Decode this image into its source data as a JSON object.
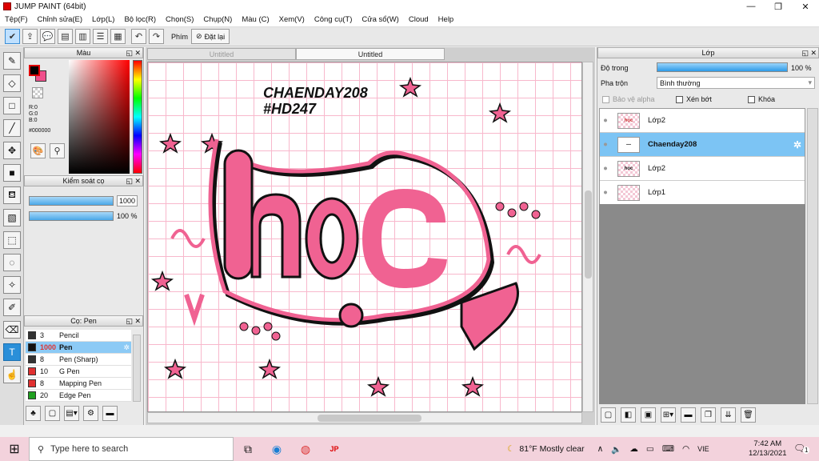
{
  "window": {
    "title": "JUMP PAINT (64bit)",
    "min": "—",
    "max": "❐",
    "close": "✕"
  },
  "menu": [
    "Tệp(F)",
    "Chỉnh sửa(E)",
    "Lớp(L)",
    "Bộ lọc(R)",
    "Chọn(S)",
    "Chụp(N)",
    "Màu (C)",
    "Xem(V)",
    "Công cụ(T)",
    "Cửa sổ(W)",
    "Cloud",
    "Help"
  ],
  "toolbar": {
    "phim_label": "Phím",
    "reset_label": "Đặt lại"
  },
  "color_panel": {
    "title": "Màu",
    "r": "R:0",
    "g": "G:0",
    "b": "B:0",
    "hex": "#000000",
    "fg_color": "#000000",
    "bg_color": "#f0508c"
  },
  "brush_control": {
    "title": "Kiểm soát cọ",
    "size_value": "1000",
    "opacity_value": "100 %"
  },
  "pen_panel": {
    "title": "Cọ: Pen",
    "items": [
      {
        "num": "3",
        "name": "Pencil",
        "color": "#333333"
      },
      {
        "num": "1000",
        "name": "Pen",
        "color": "#111111"
      },
      {
        "num": "8",
        "name": "Pen (Sharp)",
        "color": "#333333"
      },
      {
        "num": "10",
        "name": "G Pen",
        "color": "#e03030"
      },
      {
        "num": "8",
        "name": "Mapping Pen",
        "color": "#e03030"
      },
      {
        "num": "20",
        "name": "Edge Pen",
        "color": "#20a020"
      }
    ]
  },
  "canvas": {
    "tabs": [
      "Untitled",
      "Untitled"
    ],
    "text_line1": "CHAENDAY208",
    "text_line2": "#HD247",
    "art_word": "hoc",
    "accent": "#f06292"
  },
  "layer_panel": {
    "title": "Lớp",
    "opacity_label": "Độ trong",
    "opacity_value": "100 %",
    "blend_label": "Pha trộn",
    "blend_value": "Bình thường",
    "protect_alpha": "Bảo vệ alpha",
    "clipping": "Xén bớt",
    "lock": "Khóa",
    "layers": [
      {
        "name": "Lớp2",
        "thumb": "hoc"
      },
      {
        "name": "Chaenday208",
        "thumb": "—"
      },
      {
        "name": "Lớp2",
        "thumb": "hoc"
      },
      {
        "name": "Lớp1",
        "thumb": ""
      }
    ]
  },
  "taskbar": {
    "search_placeholder": "Type here to search",
    "weather": "81°F  Mostly clear",
    "lang": "VIE",
    "time": "7:42 AM",
    "date": "12/13/2021",
    "notif": "1"
  }
}
